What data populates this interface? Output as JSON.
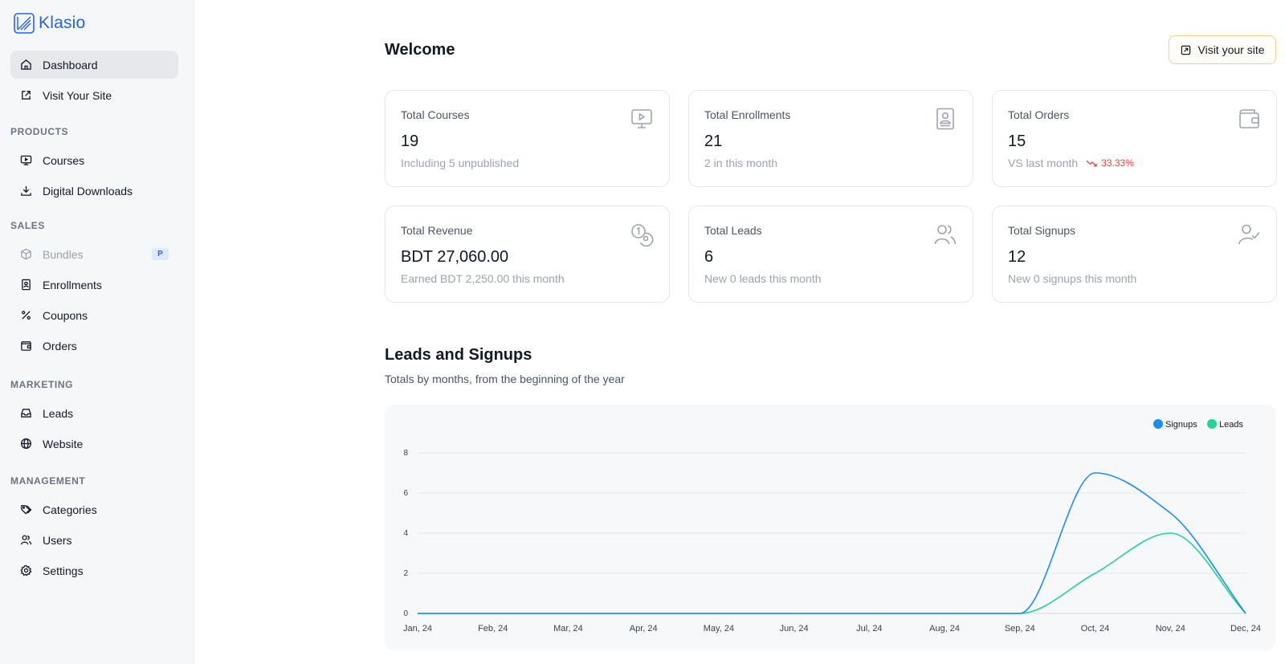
{
  "brand": {
    "name": "Klasio",
    "accent": "#2563eb"
  },
  "nav": {
    "dashboard": "Dashboard",
    "visit_site": "Visit Your Site",
    "section_products": "PRODUCTS",
    "courses": "Courses",
    "digital_downloads": "Digital Downloads",
    "section_sales": "SALES",
    "bundles": "Bundles",
    "bundles_tag": "P",
    "enrollments": "Enrollments",
    "coupons": "Coupons",
    "orders": "Orders",
    "section_marketing": "MARKETING",
    "leads": "Leads",
    "website": "Website",
    "section_management": "MANAGEMENT",
    "categories": "Categories",
    "users": "Users",
    "settings": "Settings"
  },
  "header": {
    "title": "Welcome",
    "visit_button": "Visit your site"
  },
  "cards": [
    {
      "title": "Total Courses",
      "value": "19",
      "sub": "Including 5 unpublished",
      "icon": "monitor-play-icon"
    },
    {
      "title": "Total Enrollments",
      "value": "21",
      "sub": "2 in this month",
      "icon": "contact-book-icon"
    },
    {
      "title": "Total Orders",
      "value": "15",
      "sub": "VS last month",
      "trend": "33.33%",
      "trend_color": "#ef4444",
      "icon": "wallet-icon"
    },
    {
      "title": "Total Revenue",
      "value": "BDT 27,060.00",
      "sub": "Earned BDT 2,250.00 this month",
      "icon": "coins-icon"
    },
    {
      "title": "Total Leads",
      "value": "6",
      "sub": "New 0 leads this month",
      "icon": "users-icon"
    },
    {
      "title": "Total Signups",
      "value": "12",
      "sub": "New 0 signups this month",
      "icon": "user-check-icon"
    }
  ],
  "chart_section": {
    "title": "Leads and Signups",
    "subtitle": "Totals by months, from the beginning of the year"
  },
  "chart_data": {
    "type": "line",
    "categories": [
      "Jan, 24",
      "Feb, 24",
      "Mar, 24",
      "Apr, 24",
      "May, 24",
      "Jun, 24",
      "Jul, 24",
      "Aug, 24",
      "Sep, 24",
      "Oct, 24",
      "Nov, 24",
      "Dec, 24"
    ],
    "series": [
      {
        "name": "Signups",
        "color": "#1a8ef5",
        "values": [
          0,
          0,
          0,
          0,
          0,
          0,
          0,
          0,
          0,
          7,
          5,
          0
        ]
      },
      {
        "name": "Leads",
        "color": "#22d39a",
        "values": [
          0,
          0,
          0,
          0,
          0,
          0,
          0,
          0,
          0,
          2,
          4,
          0
        ]
      }
    ],
    "yticks": [
      0,
      2,
      4,
      6,
      8
    ],
    "ylim": [
      0,
      8
    ],
    "grid": true,
    "legend": "top-right",
    "smooth": true
  }
}
